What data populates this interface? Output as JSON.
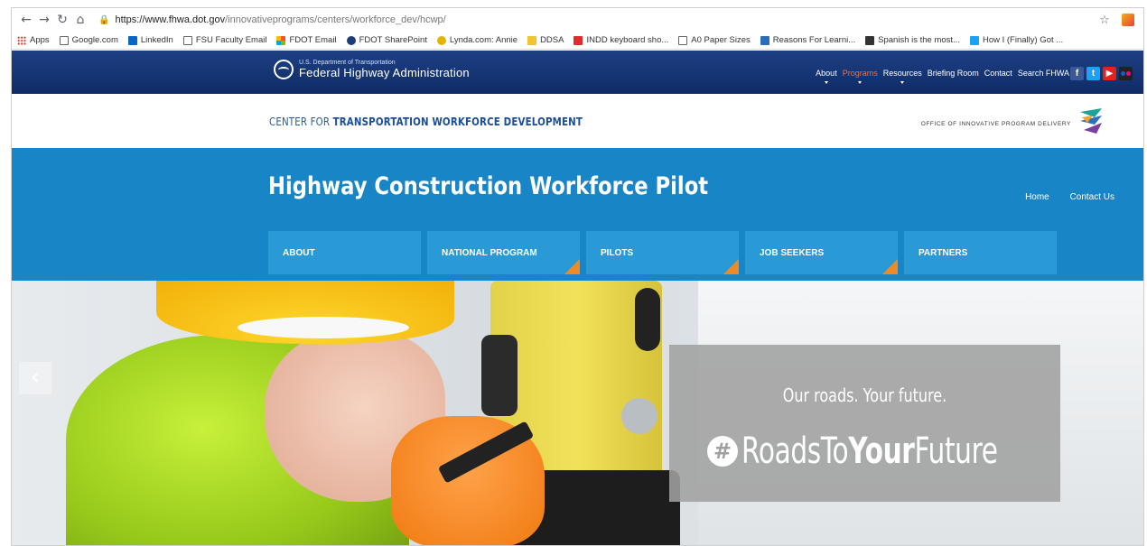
{
  "browser": {
    "url_host": "https://www.fhwa.dot.gov",
    "url_path": "/innovativeprograms/centers/workforce_dev/hcwp/",
    "bookmarks": [
      "Apps",
      "Google.com",
      "LinkedIn",
      "FSU Faculty Email",
      "FDOT Email",
      "FDOT SharePoint",
      "Lynda.com: Annie",
      "DDSA",
      "INDD keyboard sho...",
      "A0 Paper Sizes",
      "Reasons For Learni...",
      "Spanish is the most...",
      "How I (Finally) Got ..."
    ]
  },
  "fhwa": {
    "dept": "U.S. Department of Transportation",
    "agency": "Federal Highway Administration",
    "nav": [
      "About",
      "Programs",
      "Resources",
      "Briefing Room",
      "Contact",
      "Search FHWA"
    ]
  },
  "center": {
    "prefix": "CENTER FOR ",
    "bold": "TRANSPORTATION WORKFORCE DEVELOPMENT",
    "office": "OFFICE OF INNOVATIVE PROGRAM DELIVERY"
  },
  "pilot": {
    "title": "Highway Construction Workforce Pilot",
    "links": [
      "Home",
      "Contact Us"
    ],
    "menu": [
      "ABOUT",
      "NATIONAL PROGRAM",
      "PILOTS",
      "JOB SEEKERS",
      "PARTNERS"
    ]
  },
  "hero": {
    "tagline": "Our roads. Your future.",
    "hash_symbol": "#",
    "hash_part1": "RoadsTo",
    "hash_part2": "Your",
    "hash_part3": "Future"
  },
  "colors": {
    "fhwa_blue": "#0f2c66",
    "pilot_blue": "#1885c6",
    "menu_blue": "#2a9ad6",
    "accent_orange": "#f08a24"
  }
}
